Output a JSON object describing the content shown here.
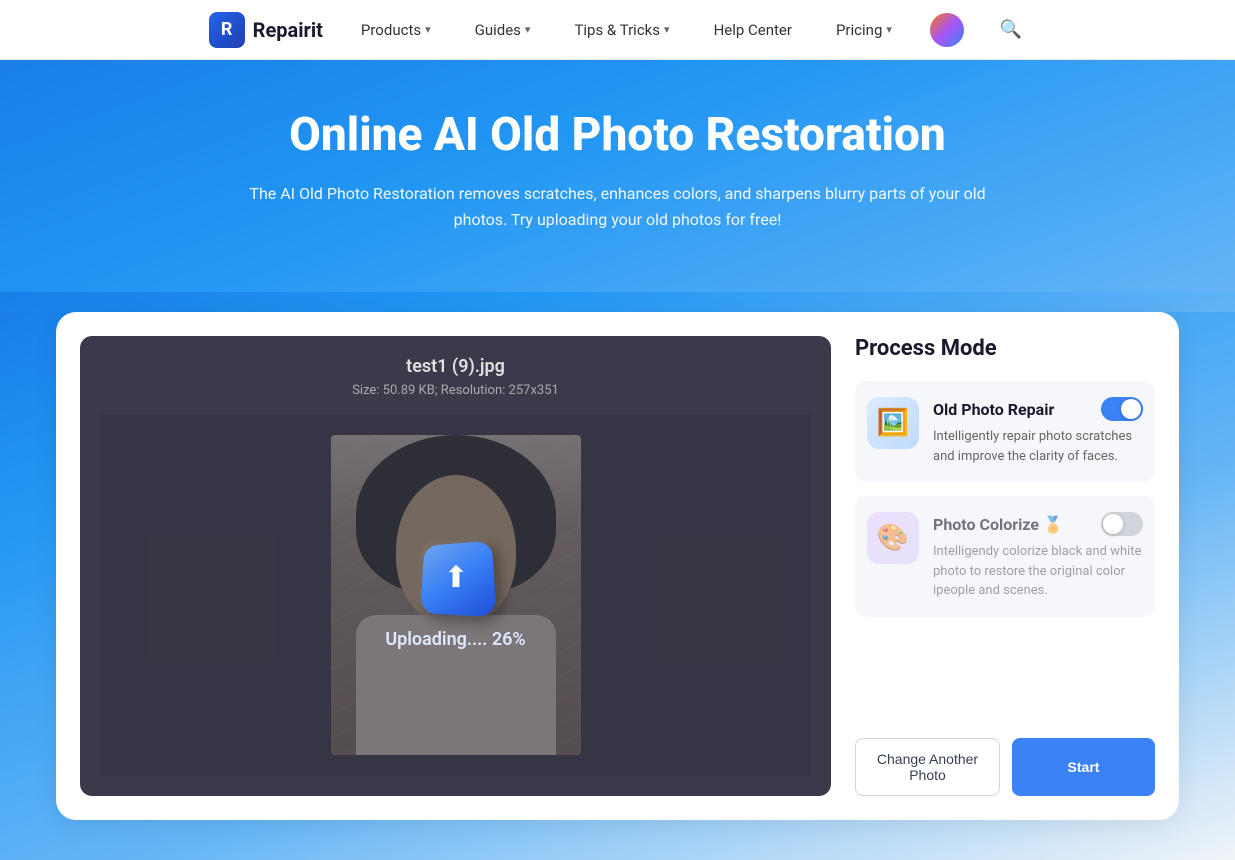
{
  "navbar": {
    "logo_text": "Repairit",
    "items": [
      {
        "label": "Products",
        "has_dropdown": true
      },
      {
        "label": "Guides",
        "has_dropdown": true
      },
      {
        "label": "Tips & Tricks",
        "has_dropdown": true
      },
      {
        "label": "Help Center",
        "has_dropdown": false
      },
      {
        "label": "Pricing",
        "has_dropdown": true
      }
    ]
  },
  "hero": {
    "title": "Online AI Old Photo Restoration",
    "subtitle": "The AI Old Photo Restoration removes scratches, enhances colors, and sharpens blurry parts of your old photos. Try uploading your old photos for free!"
  },
  "photo_area": {
    "filename": "test1 (9).jpg",
    "meta": "Size: 50.89 KB; Resolution: 257x351",
    "upload_status": "Uploading.... 26%"
  },
  "process_panel": {
    "title": "Process Mode",
    "modes": [
      {
        "name": "Old Photo Repair",
        "description": "Intelligently repair photo scratches and improve the clarity of faces.",
        "toggle_on": true,
        "premium": false
      },
      {
        "name": "Photo Colorize",
        "description": "Intelligendy colorize black and white photo to restore the original color ipeople and scenes.",
        "toggle_on": false,
        "premium": true
      }
    ],
    "btn_change": "Change Another Photo",
    "btn_start": "Start"
  }
}
